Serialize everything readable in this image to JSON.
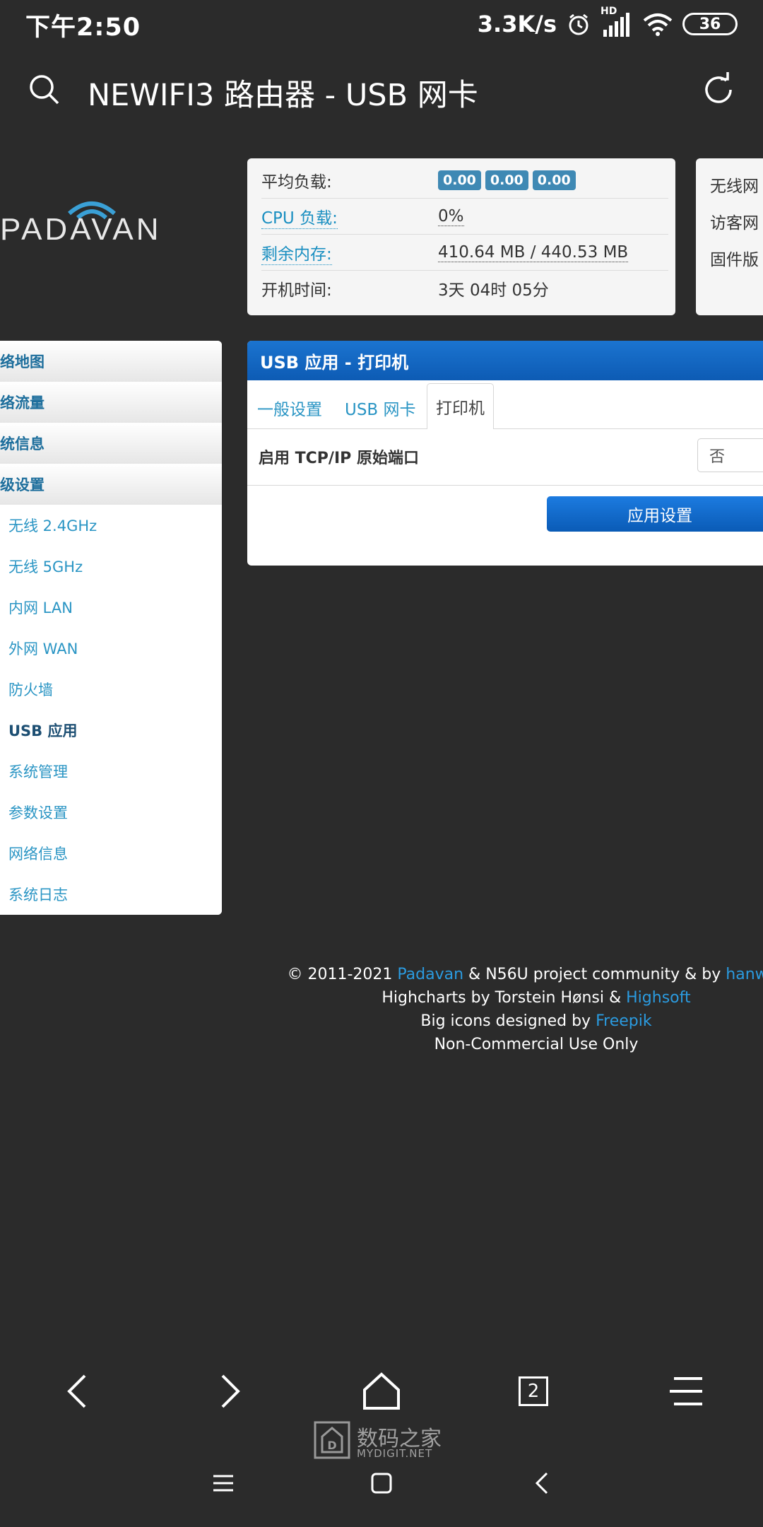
{
  "status_bar": {
    "time": "下午2:50",
    "network_speed": "3.3K/s",
    "signal_badge": "HD",
    "battery": "36"
  },
  "app_bar": {
    "title": "NEWIFI3 路由器 - USB 网卡"
  },
  "logo": {
    "text": "PADAVAN"
  },
  "info_card": {
    "load_label": "平均负载:",
    "load_values": [
      "0.00",
      "0.00",
      "0.00"
    ],
    "cpu_label": "CPU 负载:",
    "cpu_value": "0%",
    "mem_label": "剩余内存:",
    "mem_value": "410.64 MB / 440.53 MB",
    "uptime_label": "开机时间:",
    "uptime_value": "3天 04时 05分"
  },
  "info_card_2": {
    "rows": [
      "无线网",
      "访客网",
      "固件版"
    ]
  },
  "sidebar": {
    "top_items": [
      "络地图",
      "络流量",
      "统信息",
      "级设置"
    ],
    "sub_items": [
      "无线 2.4GHz",
      "无线 5GHz",
      "内网 LAN",
      "外网 WAN",
      "防火墙",
      "USB 应用",
      "系统管理",
      "参数设置",
      "网络信息",
      "系统日志"
    ],
    "active_item": "USB 应用"
  },
  "panel": {
    "header": "USB 应用 - 打印机",
    "tabs": [
      "一般设置",
      "USB 网卡",
      "打印机"
    ],
    "active_tab": "打印机",
    "setting_label": "启用 TCP/IP 原始端口",
    "setting_value": "否",
    "apply_label": "应用设置"
  },
  "footer": {
    "line1_prefix": "© 2011-2021 ",
    "line1_link1": "Padavan",
    "line1_mid": " & N56U project community & by ",
    "line1_link2": "hanwck",
    "line2_prefix": "Highcharts by Torstein Hønsi & ",
    "line2_link": "Highsoft",
    "line3_prefix": "Big icons designed by ",
    "line3_link": "Freepik",
    "line4": "Non-Commercial Use Only"
  },
  "browser_bar": {
    "tab_count": "2"
  },
  "watermark": {
    "text": "数码之家",
    "subtext": "MYDIGIT.NET"
  },
  "colors": {
    "background": "#2b2b2b",
    "accent": "#1b74d0",
    "link": "#2a95c4"
  }
}
